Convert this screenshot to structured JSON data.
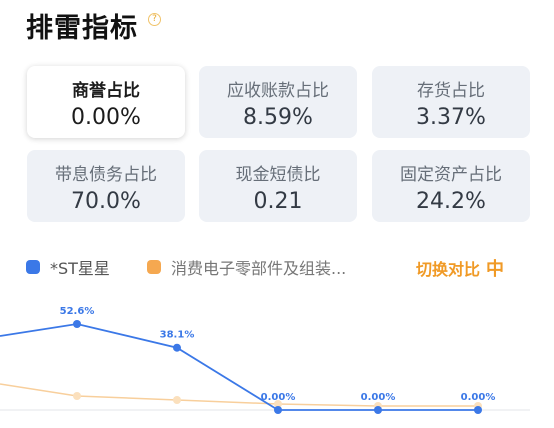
{
  "title": "排雷指标",
  "help_icon": "?",
  "cards": [
    {
      "label": "商誉占比",
      "value": "0.00%",
      "selected": true
    },
    {
      "label": "应收账款占比",
      "value": "8.59%",
      "selected": false
    },
    {
      "label": "存货占比",
      "value": "3.37%",
      "selected": false
    },
    {
      "label": "带息债务占比",
      "value": "70.0%",
      "selected": false
    },
    {
      "label": "现金短债比",
      "value": "0.21",
      "selected": false
    },
    {
      "label": "固定资产占比",
      "value": "24.2%",
      "selected": false
    }
  ],
  "legend": {
    "series1": "*ST星星",
    "series2": "消费电子零部件及组装...",
    "switch_label": "切换对比",
    "switch_icon": "中"
  },
  "colors": {
    "series1": "#3b78e7",
    "series2": "#f5a850"
  },
  "chart_data": {
    "type": "line",
    "series": [
      {
        "name": "*ST星星",
        "values": [
          null,
          52.6,
          38.1,
          0,
          0,
          0
        ],
        "labels": [
          "",
          "52.6%",
          "38.1%",
          "0.00%",
          "0.00%",
          "0.00%"
        ]
      },
      {
        "name": "消费电子零部件及组装...",
        "values": [
          null,
          null,
          null,
          null,
          null,
          null
        ]
      }
    ]
  }
}
